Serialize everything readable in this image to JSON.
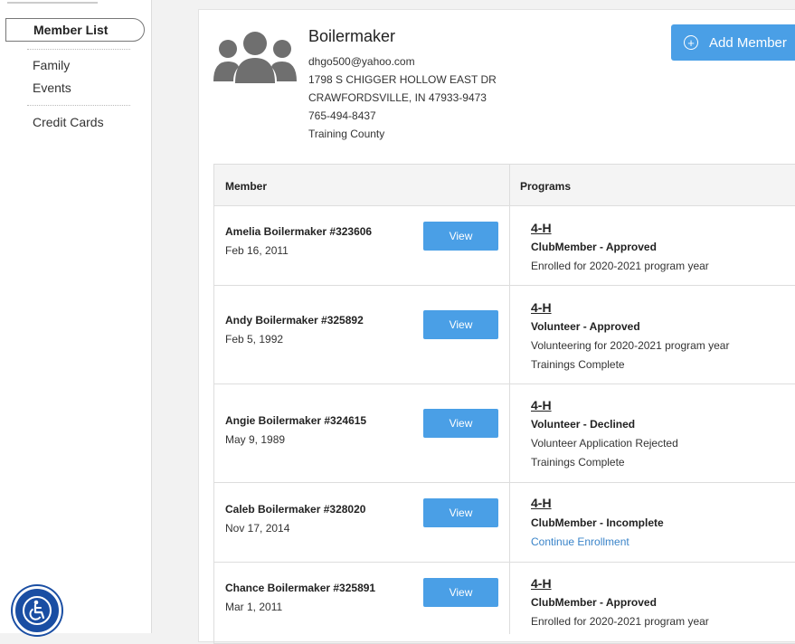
{
  "sidebar": {
    "items": [
      {
        "label": "Member List"
      },
      {
        "label": "Family"
      },
      {
        "label": "Events"
      },
      {
        "label": "Credit Cards"
      }
    ]
  },
  "family": {
    "name": "Boilermaker",
    "email": "dhgo500@yahoo.com",
    "address1": "1798 S CHIGGER HOLLOW EAST DR",
    "address2": "CRAWFORDSVILLE, IN 47933-9473",
    "phone": "765-494-8437",
    "county": "Training County"
  },
  "actions": {
    "add_member": "Add Member"
  },
  "table": {
    "headers": {
      "member": "Member",
      "programs": "Programs"
    },
    "rows": [
      {
        "name": "Amelia Boilermaker #323606",
        "date": "Feb 16, 2011",
        "view": "View",
        "program": "4-H",
        "status": "ClubMember - Approved",
        "line1": "Enrolled for 2020-2021 program year",
        "line2": ""
      },
      {
        "name": "Andy Boilermaker #325892",
        "date": "Feb 5, 1992",
        "view": "View",
        "program": "4-H",
        "status": "Volunteer - Approved",
        "line1": "Volunteering for 2020-2021 program year",
        "line2": "Trainings Complete"
      },
      {
        "name": "Angie Boilermaker #324615",
        "date": "May 9, 1989",
        "view": "View",
        "program": "4-H",
        "status": "Volunteer - Declined",
        "line1": "Volunteer Application Rejected",
        "line2": "Trainings Complete"
      },
      {
        "name": "Caleb Boilermaker #328020",
        "date": "Nov 17, 2014",
        "view": "View",
        "program": "4-H",
        "status": "ClubMember - Incomplete",
        "link": "Continue Enrollment"
      },
      {
        "name": "Chance Boilermaker #325891",
        "date": "Mar 1, 2011",
        "view": "View",
        "program": "4-H",
        "status": "ClubMember - Approved",
        "line1": "Enrolled for 2020-2021 program year"
      }
    ]
  },
  "colors": {
    "accent": "#4a9fe6",
    "link": "#3a84c9",
    "accessibility": "#1a4ea3"
  },
  "icons": [
    "group-avatar-icon",
    "plus-circle-icon",
    "accessibility-icon"
  ]
}
